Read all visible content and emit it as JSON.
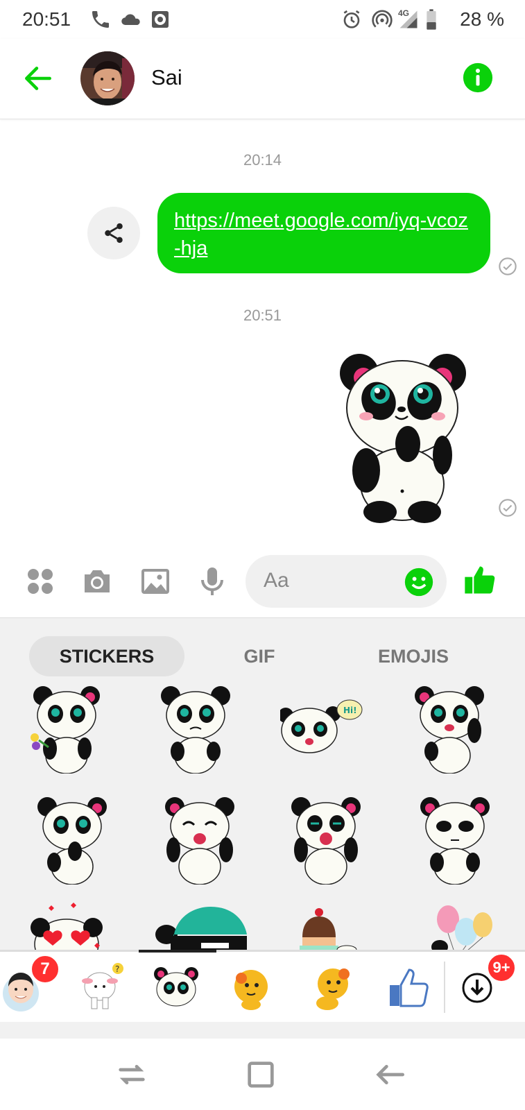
{
  "status_bar": {
    "time": "20:51",
    "battery_percent": "28 %",
    "network_label": "4G",
    "icons": [
      "phone-icon",
      "cloud-icon",
      "sync-icon",
      "alarm-icon",
      "hotspot-icon",
      "signal-icon",
      "battery-icon"
    ]
  },
  "header": {
    "contact_name": "Sai",
    "back_icon": "back-arrow-icon",
    "info_icon": "info-icon"
  },
  "messages": [
    {
      "type": "timestamp",
      "text": "20:14"
    },
    {
      "type": "link",
      "text": "https://meet.google.com/iyq-vcoz-hja"
    },
    {
      "type": "timestamp",
      "text": "20:51"
    },
    {
      "type": "sticker",
      "name": "panda-shy"
    }
  ],
  "composer": {
    "placeholder": "Aa",
    "icons": [
      "apps-icon",
      "camera-icon",
      "gallery-icon",
      "mic-icon",
      "emoji-icon",
      "like-icon"
    ]
  },
  "sticker_panel": {
    "tabs": [
      "STICKERS",
      "GIF",
      "EMOJIS"
    ],
    "active_tab": "STICKERS",
    "tray_badges": {
      "avatar_pack": "7",
      "store": "9+"
    }
  },
  "colors": {
    "accent": "#0ad10a",
    "panel_bg": "#f1f1f1",
    "badge": "#ff3030"
  }
}
